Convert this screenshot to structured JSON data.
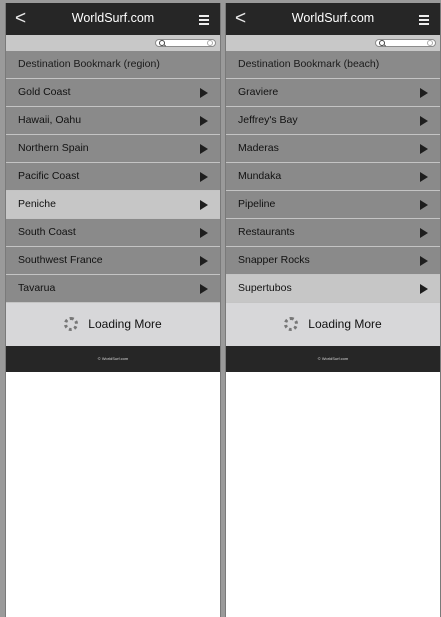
{
  "screens": {
    "left": {
      "app_title": "WorldSurf.com",
      "back_icon": "chevron-left-icon",
      "menu_icon": "menu-icon",
      "list_header": "Destination Bookmark (region)",
      "items": [
        {
          "label": "Gold Coast",
          "highlighted": false
        },
        {
          "label": "Hawaii, Oahu",
          "highlighted": false
        },
        {
          "label": "Northern Spain",
          "highlighted": false
        },
        {
          "label": "Pacific Coast",
          "highlighted": false
        },
        {
          "label": "Peniche",
          "highlighted": true
        },
        {
          "label": "South Coast",
          "highlighted": false
        },
        {
          "label": "Southwest France",
          "highlighted": false
        },
        {
          "label": "Tavarua",
          "highlighted": false
        }
      ],
      "loading_label": "Loading More",
      "footer_text": "© WorldSurf.com"
    },
    "right": {
      "app_title": "WorldSurf.com",
      "back_icon": "chevron-left-icon",
      "menu_icon": "menu-icon",
      "list_header": "Destination Bookmark (beach)",
      "items": [
        {
          "label": "Graviere",
          "highlighted": false
        },
        {
          "label": "Jeffrey's Bay",
          "highlighted": false
        },
        {
          "label": "Maderas",
          "highlighted": false
        },
        {
          "label": "Mundaka",
          "highlighted": false
        },
        {
          "label": "Pipeline",
          "highlighted": false
        },
        {
          "label": "Restaurants",
          "highlighted": false
        },
        {
          "label": "Snapper Rocks",
          "highlighted": false
        },
        {
          "label": "Supertubos",
          "highlighted": true
        }
      ],
      "loading_label": "Loading More",
      "footer_text": "© WorldSurf.com"
    }
  },
  "colors": {
    "topbar": "#262626",
    "list_item": "#8a8a8a",
    "list_item_highlight": "#c6c6c6",
    "loading_bg": "#d7d7d9",
    "background": "#9a9a9a"
  }
}
